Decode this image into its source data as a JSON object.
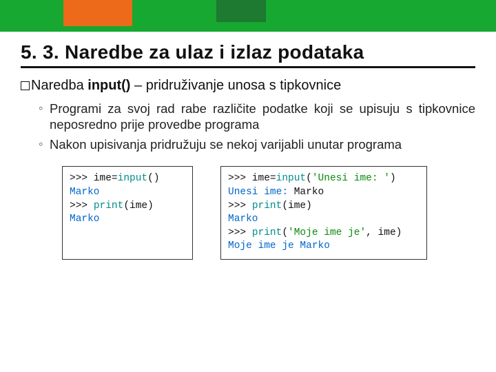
{
  "slide": {
    "title": "5. 3. Naredbe za ulaz i izlaz podataka",
    "lead_prefix": "Naredba ",
    "lead_bold": "input()",
    "lead_suffix": " – pridruživanje unosa s tipkovnice",
    "bullets": [
      "Programi za svoj rad rabe različite podatke koji se upisuju s tipkovnice neposredno prije provedbe programa",
      "Nakon upisivanja pridružuju se nekoj varijabli unutar programa"
    ]
  },
  "code1": {
    "l1a": ">>> ime=",
    "l1b": "input",
    "l1c": "()",
    "l2": "Marko",
    "l3a": ">>> ",
    "l3b": "print",
    "l3c": "(ime)",
    "l4": "Marko"
  },
  "code2": {
    "l1a": ">>> ime=",
    "l1b": "input",
    "l1c": "(",
    "l1d": "'Unesi ime: '",
    "l1e": ")",
    "l2a": "Unesi ime:",
    "l2b": " Marko",
    "l3a": ">>> ",
    "l3b": "print",
    "l3c": "(ime)",
    "l4": "Marko",
    "l5a": ">>> ",
    "l5b": "print",
    "l5c": "(",
    "l5d": "'Moje ime je'",
    "l5e": ", ime)",
    "l6": "Moje ime je Marko"
  }
}
